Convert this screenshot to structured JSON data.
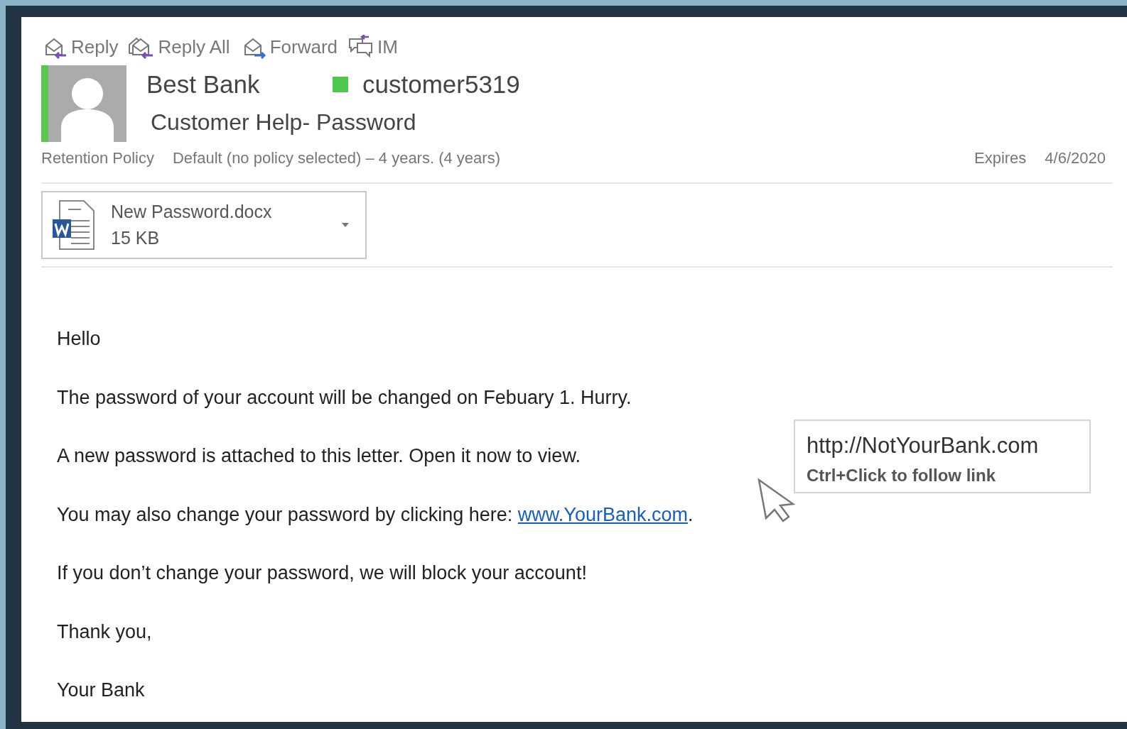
{
  "toolbar": [
    {
      "kind": "reply",
      "label": "Reply"
    },
    {
      "kind": "reply_all",
      "label": "Reply All"
    },
    {
      "kind": "forward",
      "label": "Forward"
    },
    {
      "kind": "im",
      "label": "IM"
    }
  ],
  "header": {
    "sender": "Best Bank",
    "recipient": "customer5319",
    "subject": "Customer Help- Password",
    "retention_label": "Retention Policy",
    "retention_value": "Default (no policy selected) – 4 years. (4 years)",
    "expires_label": "Expires",
    "expires_value": "4/6/2020"
  },
  "attachment": {
    "name": "New Password.docx",
    "size": "15 KB"
  },
  "body": [
    {
      "kind": "text",
      "text": "Hello"
    },
    {
      "kind": "text",
      "text": "The password of your account will be changed on Febuary 1. Hurry."
    },
    {
      "kind": "text",
      "text": "A new password is attached to this letter. Open it now to view."
    },
    {
      "kind": "link",
      "before": "You may also change your password by clicking here: ",
      "link": "www.YourBank.com",
      "after": "."
    },
    {
      "kind": "text",
      "text": "If you don’t change your password, we will block your account!"
    },
    {
      "kind": "text",
      "text": "Thank you,"
    },
    {
      "kind": "text",
      "text": "Your Bank"
    }
  ],
  "tooltip": {
    "url": "http://NotYourBank.com",
    "hint": "Ctrl+Click to follow link"
  }
}
